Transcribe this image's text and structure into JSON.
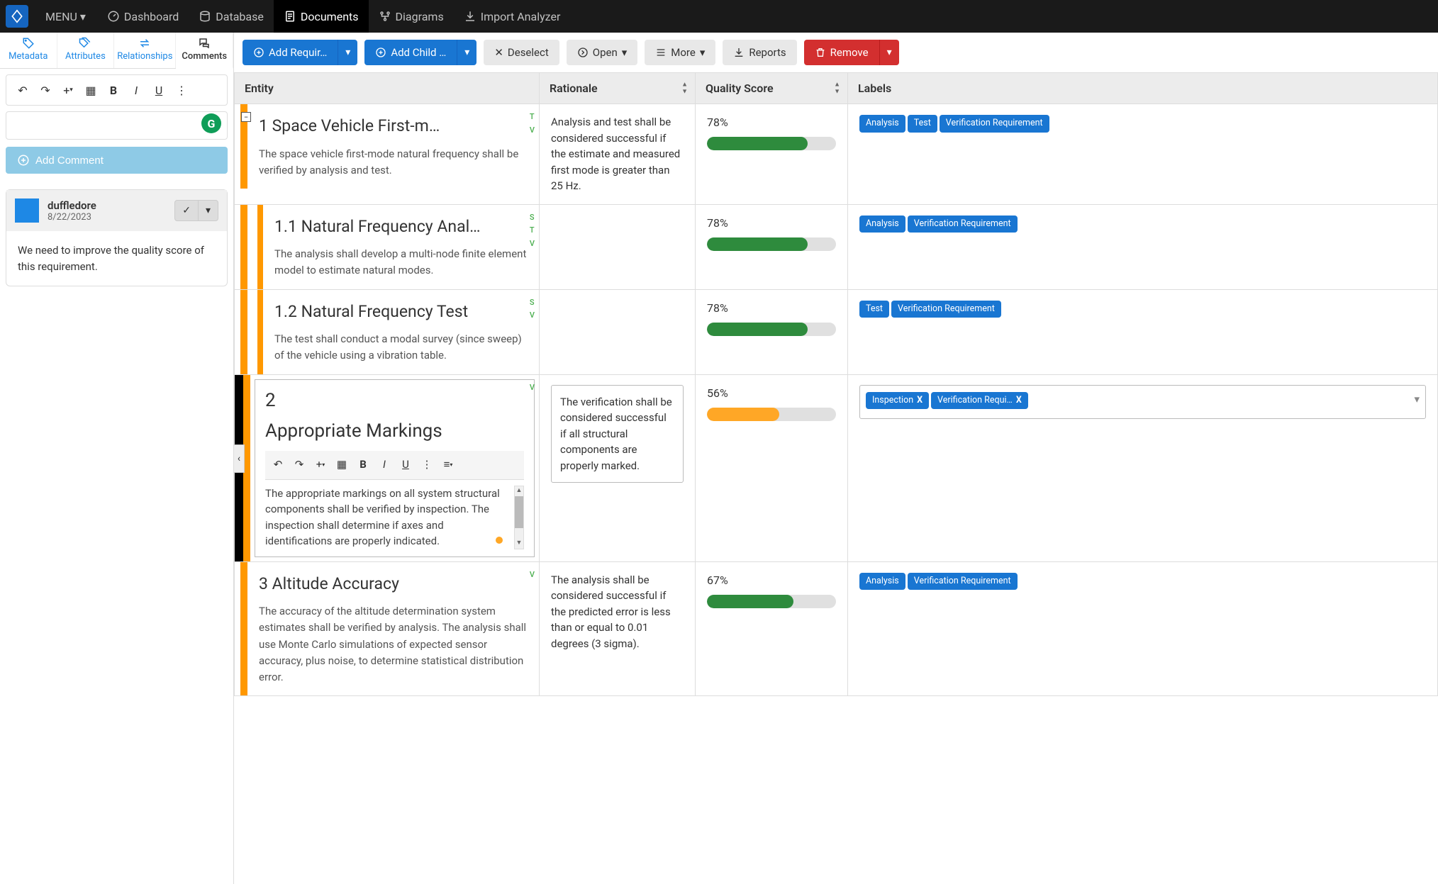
{
  "topnav": {
    "menu": "MENU",
    "items": [
      {
        "label": "Dashboard"
      },
      {
        "label": "Database"
      },
      {
        "label": "Documents",
        "active": true
      },
      {
        "label": "Diagrams"
      },
      {
        "label": "Import Analyzer"
      }
    ]
  },
  "leftTabs": [
    {
      "label": "Metadata"
    },
    {
      "label": "Attributes"
    },
    {
      "label": "Relationships"
    },
    {
      "label": "Comments",
      "active": true
    }
  ],
  "addCommentLabel": "Add Comment",
  "comment": {
    "user": "duffledore",
    "date": "8/22/2023",
    "body": "We need to improve the quality score of this requirement."
  },
  "actions": {
    "addReq": "Add Requir…",
    "addChild": "Add Child …",
    "deselect": "Deselect",
    "open": "Open",
    "more": "More",
    "reports": "Reports",
    "remove": "Remove"
  },
  "columns": {
    "entity": "Entity",
    "rationale": "Rationale",
    "quality": "Quality Score",
    "labels": "Labels"
  },
  "rows": [
    {
      "num": "1",
      "title": "Space Vehicle First-m…",
      "desc": "The space vehicle first-mode natural frequency shall be verified by analysis and test.",
      "vtags": [
        "T",
        "V"
      ],
      "rationale": "Analysis and test shall be considered successful if the estimate and measured first mode is greater than 25 Hz.",
      "quality": "78%",
      "qpct": 78,
      "qcolor": "green",
      "labels": [
        "Analysis",
        "Test",
        "Verification Requirement"
      ],
      "indent": 0
    },
    {
      "num": "1.1",
      "title": "Natural Frequency Anal…",
      "desc": "The analysis shall develop a multi-node finite element model to estimate natural modes.",
      "vtags": [
        "S",
        "T",
        "V"
      ],
      "rationale": "",
      "quality": "78%",
      "qpct": 78,
      "qcolor": "green",
      "labels": [
        "Analysis",
        "Verification Requirement"
      ],
      "indent": 1
    },
    {
      "num": "1.2",
      "title": "Natural Frequency Test",
      "desc": "The test shall conduct a modal survey (since sweep) of the vehicle using a vibration table.",
      "vtags": [
        "S",
        "V"
      ],
      "rationale": "",
      "quality": "78%",
      "qpct": 78,
      "qcolor": "green",
      "labels": [
        "Test",
        "Verification Requirement"
      ],
      "indent": 1
    },
    {
      "num": "2",
      "title": "Appropriate Markings",
      "desc": "The appropriate markings on all system structural components shall be verified by inspection. The inspection shall determine if axes and identifications are properly indicated.",
      "vtags": [
        "V"
      ],
      "rationale": "The verification shall be considered successful if all structural components are properly marked.",
      "quality": "56%",
      "qpct": 56,
      "qcolor": "orange",
      "labels": [
        "Inspection",
        "Verification Requi…"
      ],
      "selected": true,
      "indent": 0
    },
    {
      "num": "3",
      "title": "Altitude Accuracy",
      "desc": "The accuracy of the altitude determination system estimates shall be verified by analysis. The analysis shall use Monte Carlo simulations of expected sensor accuracy, plus noise, to determine statistical distribution error.",
      "vtags": [
        "V"
      ],
      "rationale": "The analysis shall be considered successful if the predicted error is less than or equal to 0.01 degrees (3 sigma).",
      "quality": "67%",
      "qpct": 67,
      "qcolor": "green",
      "labels": [
        "Analysis",
        "Verification Requirement"
      ],
      "indent": 0
    }
  ]
}
